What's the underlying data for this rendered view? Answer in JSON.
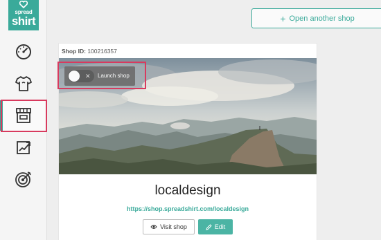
{
  "logo": {
    "line1": "spread",
    "line2": "shirt"
  },
  "sidebar": {
    "items": [
      {
        "icon": "dashboard-gauge-icon",
        "active": false
      },
      {
        "icon": "tshirt-icon",
        "active": false
      },
      {
        "icon": "shop-storefront-icon",
        "active": true
      },
      {
        "icon": "marketing-chart-icon",
        "active": false
      },
      {
        "icon": "target-icon",
        "active": false
      }
    ]
  },
  "header": {
    "open_shop_label": "Open another shop",
    "open_shop_icon": "+"
  },
  "shop": {
    "id_label": "Shop ID:",
    "id_value": "100216357",
    "launch_label": "Launch shop",
    "toggle_off_glyph": "✕",
    "name": "localdesign",
    "url": "https://shop.spreadshirt.com/localdesign",
    "visit_label": "Visit shop",
    "edit_label": "Edit"
  },
  "colors": {
    "accent": "#3aaa9a",
    "highlight": "#d83a5e"
  }
}
